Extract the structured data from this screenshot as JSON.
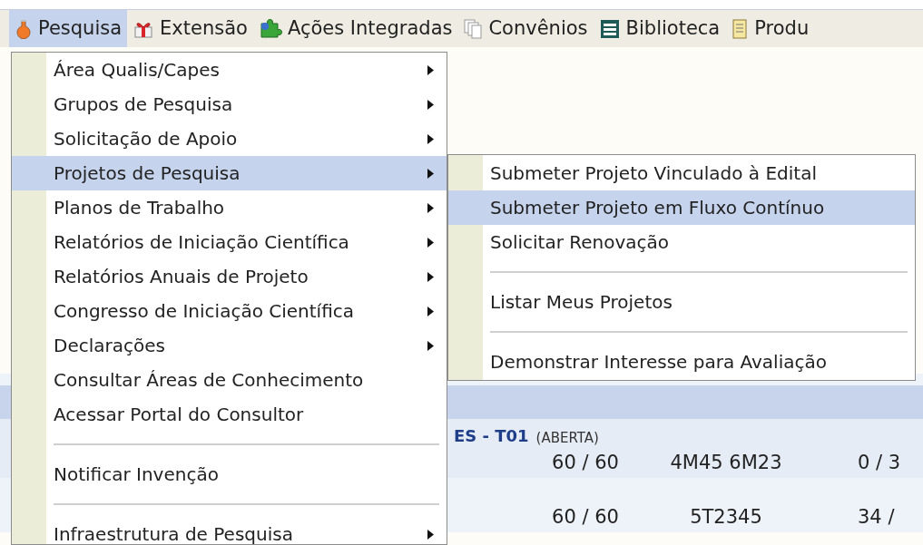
{
  "menubar": [
    {
      "label": "Pesquisa",
      "selected": true
    },
    {
      "label": "Extensão",
      "selected": false
    },
    {
      "label": "Ações Integradas",
      "selected": false
    },
    {
      "label": "Convênios",
      "selected": false
    },
    {
      "label": "Biblioteca",
      "selected": false
    },
    {
      "label": "Produ",
      "selected": false
    }
  ],
  "menu": [
    {
      "kind": "item",
      "label": "Área Qualis/Capes",
      "submenu": true,
      "selected": false
    },
    {
      "kind": "item",
      "label": "Grupos de Pesquisa",
      "submenu": true,
      "selected": false
    },
    {
      "kind": "item",
      "label": "Solicitação de Apoio",
      "submenu": true,
      "selected": false
    },
    {
      "kind": "item",
      "label": "Projetos de Pesquisa",
      "submenu": true,
      "selected": true
    },
    {
      "kind": "item",
      "label": "Planos de Trabalho",
      "submenu": true,
      "selected": false
    },
    {
      "kind": "item",
      "label": "Relatórios de Iniciação Científica",
      "submenu": true,
      "selected": false
    },
    {
      "kind": "item",
      "label": "Relatórios Anuais de Projeto",
      "submenu": true,
      "selected": false
    },
    {
      "kind": "item",
      "label": "Congresso de Iniciação Científica",
      "submenu": true,
      "selected": false
    },
    {
      "kind": "item",
      "label": "Declarações",
      "submenu": true,
      "selected": false
    },
    {
      "kind": "item",
      "label": "Consultar Áreas de Conhecimento",
      "submenu": false,
      "selected": false
    },
    {
      "kind": "item",
      "label": "Acessar Portal do Consultor",
      "submenu": false,
      "selected": false
    },
    {
      "kind": "separator"
    },
    {
      "kind": "item",
      "label": "Notificar Invenção",
      "submenu": false,
      "selected": false
    },
    {
      "kind": "separator"
    },
    {
      "kind": "item",
      "label": "Infraestrutura de Pesquisa",
      "submenu": true,
      "selected": false
    }
  ],
  "submenu": [
    {
      "kind": "item",
      "label": "Submeter Projeto Vinculado à Edital",
      "selected": false
    },
    {
      "kind": "item",
      "label": "Submeter Projeto em Fluxo Contínuo",
      "selected": true
    },
    {
      "kind": "item",
      "label": "Solicitar Renovação",
      "selected": false
    },
    {
      "kind": "separator"
    },
    {
      "kind": "item",
      "label": "Listar Meus Projetos",
      "selected": false
    },
    {
      "kind": "separator"
    },
    {
      "kind": "item",
      "label": "Demonstrar Interesse para Avaliação",
      "selected": false
    }
  ],
  "table": {
    "group_title": "ES - T01",
    "group_status": "(ABERTA)",
    "rows": [
      [
        "60 / 60",
        "4M45 6M23",
        "0 / 3"
      ],
      [
        "60 / 60",
        "5T2345",
        "34 /"
      ]
    ]
  }
}
